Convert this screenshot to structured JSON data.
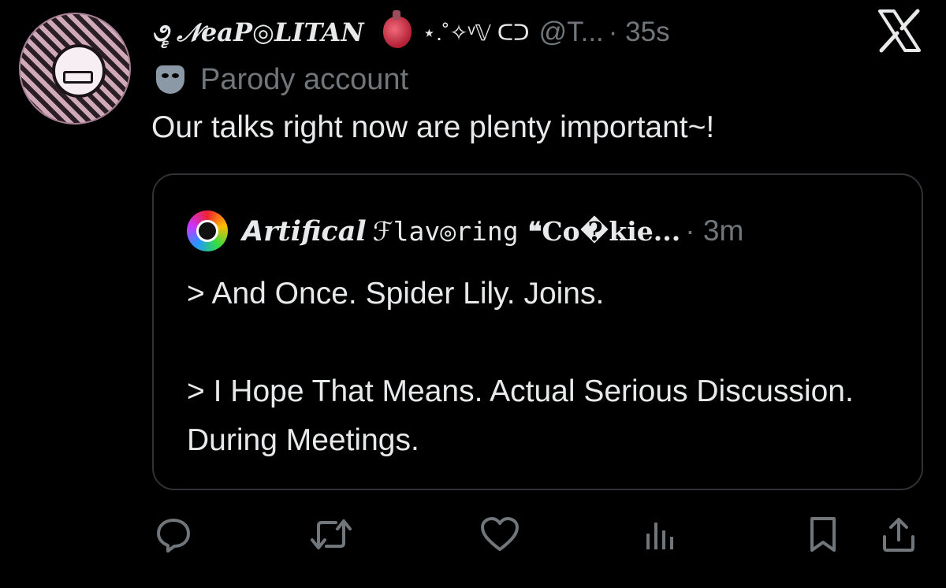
{
  "tweet": {
    "display_name": "𝒩eaP◎LITAN",
    "display_name_prefix": "૭ૄ",
    "decor": "⋆.˚✧ᵛ𝕍 ᑕᑐ",
    "handle": "@T...",
    "time": "· 35s",
    "parody_label": "Parody account",
    "text": "Our talks right now are plenty important~!"
  },
  "quote": {
    "name": "𝘼rtifical",
    "name_mono": "ℱlav◎ring",
    "name_bold": "❝Co�kie...",
    "time": "· 3m",
    "line1": "> And Once. Spider Lily. Joins.",
    "line2": "> I Hope That Means. Actual Serious Discussion. During Meetings."
  },
  "icons": {
    "close": "x-logo-icon",
    "reply": "reply-icon",
    "retweet": "retweet-icon",
    "like": "heart-icon",
    "views": "views-icon",
    "bookmark": "bookmark-icon",
    "share": "share-icon"
  },
  "colors": {
    "background": "#000000",
    "text": "#e7e9ea",
    "muted": "#71767b",
    "border": "#2f3336"
  }
}
